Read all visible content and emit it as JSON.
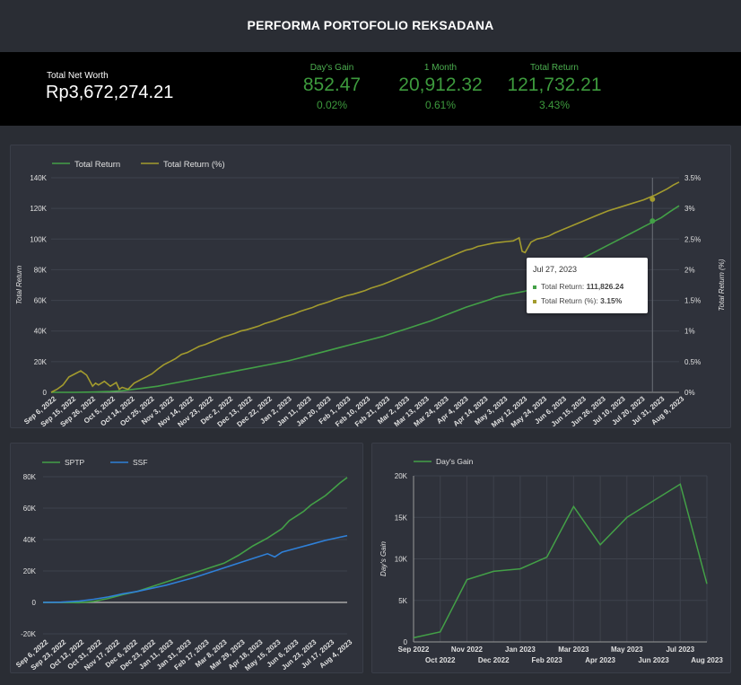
{
  "header": {
    "title": "PERFORMA PORTOFOLIO REKSADANA"
  },
  "kpis": {
    "net_worth": {
      "label": "Total Net Worth",
      "value": "Rp3,672,274.21"
    },
    "days_gain": {
      "label": "Day's Gain",
      "value": "852.47",
      "pct": "0.02%"
    },
    "one_month": {
      "label": "1 Month",
      "value": "20,912.32",
      "pct": "0.61%"
    },
    "total_return": {
      "label": "Total Return",
      "value": "121,732.21",
      "pct": "3.43%"
    }
  },
  "colors": {
    "green": "#43a047",
    "olive": "#a39b2e",
    "blue": "#2f80d8",
    "panel": "#2f323b"
  },
  "tooltip": {
    "date": "Jul 27, 2023",
    "row1_label": "Total Return:",
    "row1_value": "111,826.24",
    "row2_label": "Total Return (%):",
    "row2_value": "3.15%"
  },
  "chart_data": [
    {
      "type": "line",
      "legend_position": "top-left",
      "series": [
        {
          "name": "Total Return",
          "axis": "left",
          "points": [
            [
              0,
              0
            ],
            [
              8,
              0
            ],
            [
              14,
              200
            ],
            [
              20,
              500
            ],
            [
              24,
              1000
            ],
            [
              28,
              2000
            ],
            [
              32,
              3000
            ],
            [
              36,
              4000
            ],
            [
              40,
              5500
            ],
            [
              44,
              7000
            ],
            [
              48,
              8500
            ],
            [
              52,
              10000
            ],
            [
              56,
              11500
            ],
            [
              60,
              13000
            ],
            [
              64,
              14500
            ],
            [
              68,
              16000
            ],
            [
              72,
              17500
            ],
            [
              76,
              19000
            ],
            [
              80,
              20500
            ],
            [
              84,
              22500
            ],
            [
              88,
              24500
            ],
            [
              92,
              26500
            ],
            [
              96,
              28500
            ],
            [
              100,
              30500
            ],
            [
              104,
              32500
            ],
            [
              108,
              34500
            ],
            [
              112,
              36500
            ],
            [
              116,
              39000
            ],
            [
              120,
              41500
            ],
            [
              124,
              44000
            ],
            [
              128,
              46500
            ],
            [
              132,
              49500
            ],
            [
              136,
              52500
            ],
            [
              140,
              55500
            ],
            [
              144,
              58000
            ],
            [
              148,
              60500
            ],
            [
              150,
              62000
            ],
            [
              153,
              63500
            ],
            [
              156,
              64500
            ],
            [
              160,
              66000
            ],
            [
              164,
              68500
            ],
            [
              168,
              73000
            ],
            [
              170,
              77000
            ],
            [
              173,
              80000
            ],
            [
              176,
              84000
            ],
            [
              180,
              88000
            ],
            [
              184,
              92000
            ],
            [
              188,
              96000
            ],
            [
              192,
              100000
            ],
            [
              196,
              104000
            ],
            [
              200,
              108000
            ],
            [
              204,
              112000
            ],
            [
              206,
              114000
            ],
            [
              209,
              118000
            ],
            [
              212,
              121700
            ]
          ]
        },
        {
          "name": "Total Return (%)",
          "axis": "right",
          "points": [
            [
              0,
              0
            ],
            [
              2,
              0.05
            ],
            [
              4,
              0.12
            ],
            [
              6,
              0.25
            ],
            [
              8,
              0.3
            ],
            [
              10,
              0.35
            ],
            [
              12,
              0.28
            ],
            [
              14,
              0.1
            ],
            [
              15,
              0.15
            ],
            [
              16,
              0.12
            ],
            [
              18,
              0.18
            ],
            [
              20,
              0.1
            ],
            [
              22,
              0.16
            ],
            [
              23,
              0.05
            ],
            [
              24,
              0.08
            ],
            [
              26,
              0.05
            ],
            [
              28,
              0.15
            ],
            [
              30,
              0.2
            ],
            [
              32,
              0.25
            ],
            [
              34,
              0.3
            ],
            [
              36,
              0.38
            ],
            [
              38,
              0.45
            ],
            [
              40,
              0.5
            ],
            [
              42,
              0.55
            ],
            [
              44,
              0.62
            ],
            [
              46,
              0.65
            ],
            [
              48,
              0.7
            ],
            [
              50,
              0.75
            ],
            [
              52,
              0.78
            ],
            [
              54,
              0.82
            ],
            [
              56,
              0.86
            ],
            [
              58,
              0.9
            ],
            [
              60,
              0.93
            ],
            [
              62,
              0.96
            ],
            [
              64,
              1.0
            ],
            [
              66,
              1.02
            ],
            [
              68,
              1.05
            ],
            [
              70,
              1.08
            ],
            [
              72,
              1.12
            ],
            [
              74,
              1.15
            ],
            [
              76,
              1.18
            ],
            [
              78,
              1.22
            ],
            [
              80,
              1.25
            ],
            [
              82,
              1.28
            ],
            [
              84,
              1.32
            ],
            [
              86,
              1.35
            ],
            [
              88,
              1.38
            ],
            [
              90,
              1.42
            ],
            [
              92,
              1.45
            ],
            [
              94,
              1.48
            ],
            [
              96,
              1.52
            ],
            [
              98,
              1.55
            ],
            [
              100,
              1.58
            ],
            [
              102,
              1.6
            ],
            [
              104,
              1.63
            ],
            [
              106,
              1.66
            ],
            [
              108,
              1.7
            ],
            [
              110,
              1.73
            ],
            [
              112,
              1.76
            ],
            [
              114,
              1.8
            ],
            [
              116,
              1.84
            ],
            [
              118,
              1.88
            ],
            [
              120,
              1.92
            ],
            [
              122,
              1.96
            ],
            [
              124,
              2.0
            ],
            [
              126,
              2.04
            ],
            [
              128,
              2.08
            ],
            [
              130,
              2.12
            ],
            [
              132,
              2.16
            ],
            [
              134,
              2.2
            ],
            [
              136,
              2.24
            ],
            [
              138,
              2.28
            ],
            [
              140,
              2.32
            ],
            [
              142,
              2.34
            ],
            [
              144,
              2.38
            ],
            [
              146,
              2.4
            ],
            [
              148,
              2.42
            ],
            [
              150,
              2.44
            ],
            [
              152,
              2.45
            ],
            [
              154,
              2.46
            ],
            [
              156,
              2.47
            ],
            [
              158,
              2.52
            ],
            [
              159,
              2.3
            ],
            [
              160,
              2.28
            ],
            [
              162,
              2.45
            ],
            [
              164,
              2.5
            ],
            [
              166,
              2.52
            ],
            [
              168,
              2.55
            ],
            [
              170,
              2.6
            ],
            [
              172,
              2.64
            ],
            [
              174,
              2.68
            ],
            [
              176,
              2.72
            ],
            [
              178,
              2.76
            ],
            [
              180,
              2.8
            ],
            [
              184,
              2.88
            ],
            [
              188,
              2.96
            ],
            [
              192,
              3.02
            ],
            [
              196,
              3.08
            ],
            [
              200,
              3.14
            ],
            [
              204,
              3.22
            ],
            [
              208,
              3.32
            ],
            [
              210,
              3.38
            ],
            [
              212,
              3.43
            ]
          ]
        }
      ],
      "y_left": {
        "label": "Total Return",
        "range": [
          0,
          140000
        ],
        "ticks": [
          "0",
          "20K",
          "40K",
          "60K",
          "80K",
          "100K",
          "120K",
          "140K"
        ]
      },
      "y_right": {
        "label": "Total Return (%)",
        "range": [
          0,
          3.5
        ],
        "ticks": [
          "0%",
          "0.5%",
          "1%",
          "1.5%",
          "2%",
          "2.5%",
          "3%",
          "3.5%"
        ]
      },
      "x_ticks": [
        "Sep 6, 2022",
        "Sep 15, 2022",
        "Sep 26, 2022",
        "Oct 5, 2022",
        "Oct 14, 2022",
        "Oct 25, 2022",
        "Nov 3, 2022",
        "Nov 14, 2022",
        "Nov 23, 2022",
        "Dec 2, 2022",
        "Dec 13, 2022",
        "Dec 22, 2022",
        "Jan 2, 2023",
        "Jan 11, 2023",
        "Jan 20, 2023",
        "Feb 1, 2023",
        "Feb 10, 2023",
        "Feb 21, 2023",
        "Mar 2, 2023",
        "Mar 13, 2023",
        "Mar 24, 2023",
        "Apr 4, 2023",
        "Apr 14, 2023",
        "May 3, 2023",
        "May 12, 2023",
        "May 24, 2023",
        "Jun 6, 2023",
        "Jun 15, 2023",
        "Jun 26, 2023",
        "Jul 10, 2023",
        "Jul 20, 2023",
        "Jul 31, 2023",
        "Aug 9, 2023"
      ],
      "hover": {
        "x": 203,
        "values": [
          111826.24,
          3.15
        ]
      }
    },
    {
      "type": "line",
      "legend_position": "top-left",
      "series": [
        {
          "name": "SPTP",
          "points": [
            [
              0,
              0
            ],
            [
              10,
              0
            ],
            [
              20,
              -200
            ],
            [
              28,
              600
            ],
            [
              36,
              2500
            ],
            [
              44,
              5000
            ],
            [
              52,
              7000
            ],
            [
              60,
              10000
            ],
            [
              68,
              13000
            ],
            [
              76,
              16000
            ],
            [
              84,
              19000
            ],
            [
              92,
              22000
            ],
            [
              100,
              25000
            ],
            [
              108,
              30000
            ],
            [
              116,
              36000
            ],
            [
              124,
              41000
            ],
            [
              132,
              47000
            ],
            [
              136,
              52000
            ],
            [
              140,
              55000
            ],
            [
              144,
              58000
            ],
            [
              148,
              62000
            ],
            [
              152,
              65000
            ],
            [
              156,
              68000
            ],
            [
              160,
              72000
            ],
            [
              164,
              76000
            ],
            [
              168,
              79500
            ]
          ]
        },
        {
          "name": "SSF",
          "points": [
            [
              0,
              0
            ],
            [
              10,
              200
            ],
            [
              20,
              800
            ],
            [
              28,
              2000
            ],
            [
              36,
              3500
            ],
            [
              44,
              5500
            ],
            [
              52,
              7000
            ],
            [
              60,
              9000
            ],
            [
              68,
              11000
            ],
            [
              76,
              13500
            ],
            [
              84,
              16000
            ],
            [
              92,
              19000
            ],
            [
              100,
              22000
            ],
            [
              108,
              25000
            ],
            [
              116,
              28000
            ],
            [
              124,
              31000
            ],
            [
              128,
              29000
            ],
            [
              132,
              32000
            ],
            [
              140,
              34500
            ],
            [
              148,
              37000
            ],
            [
              156,
              39500
            ],
            [
              164,
              41500
            ],
            [
              168,
              42500
            ]
          ]
        }
      ],
      "y": {
        "range": [
          -20000,
          80000
        ],
        "ticks": [
          "-20K",
          "0",
          "20K",
          "40K",
          "60K",
          "80K"
        ]
      },
      "x_ticks": [
        "Sep 6, 2022",
        "Sep 23, 2022",
        "Oct 12, 2022",
        "Oct 31, 2022",
        "Nov 17, 2022",
        "Dec 6, 2022",
        "Dec 23, 2022",
        "Jan 11, 2023",
        "Jan 31, 2023",
        "Feb 17, 2023",
        "Mar 8, 2023",
        "Mar 29, 2023",
        "Apr 18, 2023",
        "May 15, 2023",
        "Jun 6, 2023",
        "Jun 23, 2023",
        "Jul 17, 2023",
        "Aug 4, 2023"
      ]
    },
    {
      "type": "line",
      "legend_position": "top-left",
      "series": [
        {
          "name": "Day's Gain",
          "points": [
            [
              0,
              500
            ],
            [
              1,
              1200
            ],
            [
              2,
              7500
            ],
            [
              3,
              8500
            ],
            [
              4,
              8800
            ],
            [
              5,
              10200
            ],
            [
              6,
              16300
            ],
            [
              7,
              11700
            ],
            [
              8,
              15000
            ],
            [
              9,
              17000
            ],
            [
              10,
              19000
            ],
            [
              11,
              7000
            ]
          ]
        }
      ],
      "categories": [
        "Sep 2022",
        "Oct 2022",
        "Nov 2022",
        "Dec 2022",
        "Jan 2023",
        "Feb 2023",
        "Mar 2023",
        "Apr 2023",
        "May 2023",
        "Jun 2023",
        "Jul 2023",
        "Aug 2023"
      ],
      "y": {
        "label": "Day's Gain",
        "range": [
          0,
          20000
        ],
        "ticks": [
          "0",
          "5K",
          "10K",
          "15K",
          "20K"
        ]
      }
    }
  ]
}
